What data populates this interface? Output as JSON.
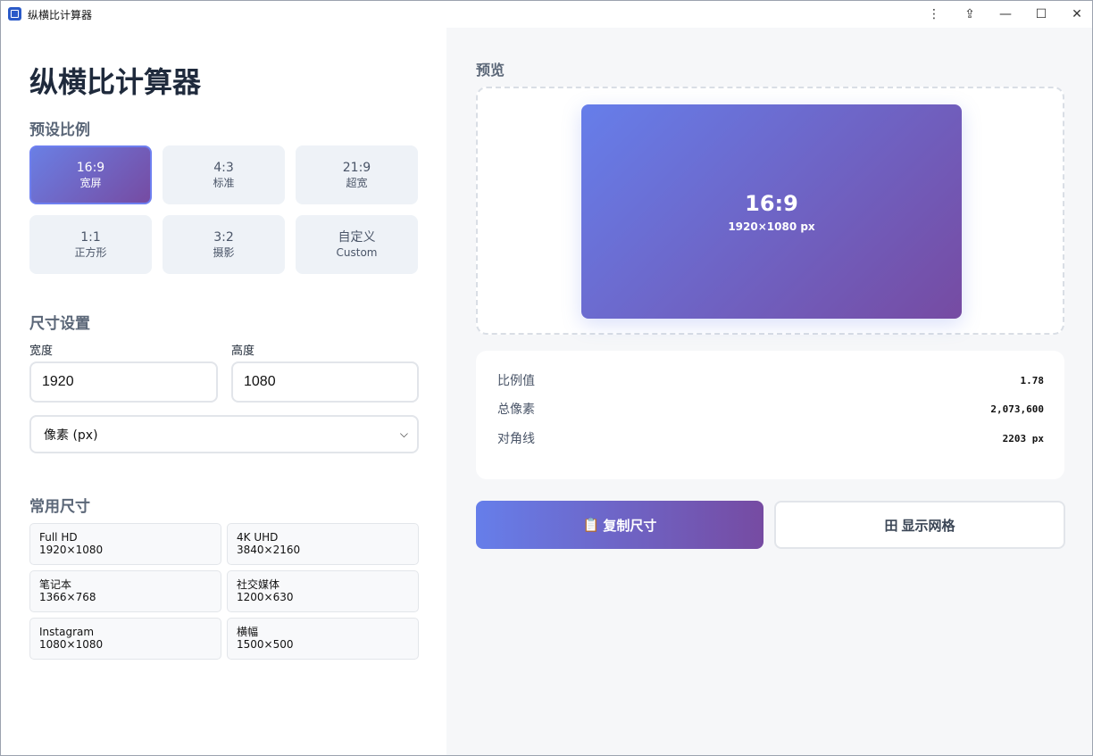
{
  "window": {
    "title": "纵横比计算器",
    "buttons": {
      "more": "⋮",
      "pin": "⇪",
      "minimize": "—",
      "maximize": "☐",
      "close": "✕"
    }
  },
  "left": {
    "heading": "纵横比计算器",
    "presets_title": "预设比例",
    "presets": [
      {
        "main": "16:9",
        "sub": "宽屏",
        "active": true
      },
      {
        "main": "4:3",
        "sub": "标准",
        "active": false
      },
      {
        "main": "21:9",
        "sub": "超宽",
        "active": false
      },
      {
        "main": "1:1",
        "sub": "正方形",
        "active": false
      },
      {
        "main": "3:2",
        "sub": "摄影",
        "active": false
      },
      {
        "main": "自定义",
        "sub": "Custom",
        "active": false
      }
    ],
    "size_title": "尺寸设置",
    "width_label": "宽度",
    "width_value": "1920",
    "height_label": "高度",
    "height_value": "1080",
    "unit_select": "像素 (px)",
    "common_title": "常用尺寸",
    "common_sizes": [
      {
        "name": "Full HD",
        "dims": "1920×1080"
      },
      {
        "name": "4K UHD",
        "dims": "3840×2160"
      },
      {
        "name": "笔记本",
        "dims": "1366×768"
      },
      {
        "name": "社交媒体",
        "dims": "1200×630"
      },
      {
        "name": "Instagram",
        "dims": "1080×1080"
      },
      {
        "name": "横幅",
        "dims": "1500×500"
      }
    ]
  },
  "right": {
    "preview_title": "预览",
    "preview_ratio": "16:9",
    "preview_dims": "1920×1080 px",
    "stats": [
      {
        "label": "比例值",
        "value": "1.78"
      },
      {
        "label": "总像素",
        "value": "2,073,600"
      },
      {
        "label": "对角线",
        "value": "2203 px"
      }
    ],
    "copy_button": {
      "icon": "📋",
      "label": "复制尺寸"
    },
    "grid_button": {
      "icon": "田",
      "label": "显示网格"
    }
  },
  "colors": {
    "accent_start": "#667eea",
    "accent_end": "#764ba2"
  }
}
